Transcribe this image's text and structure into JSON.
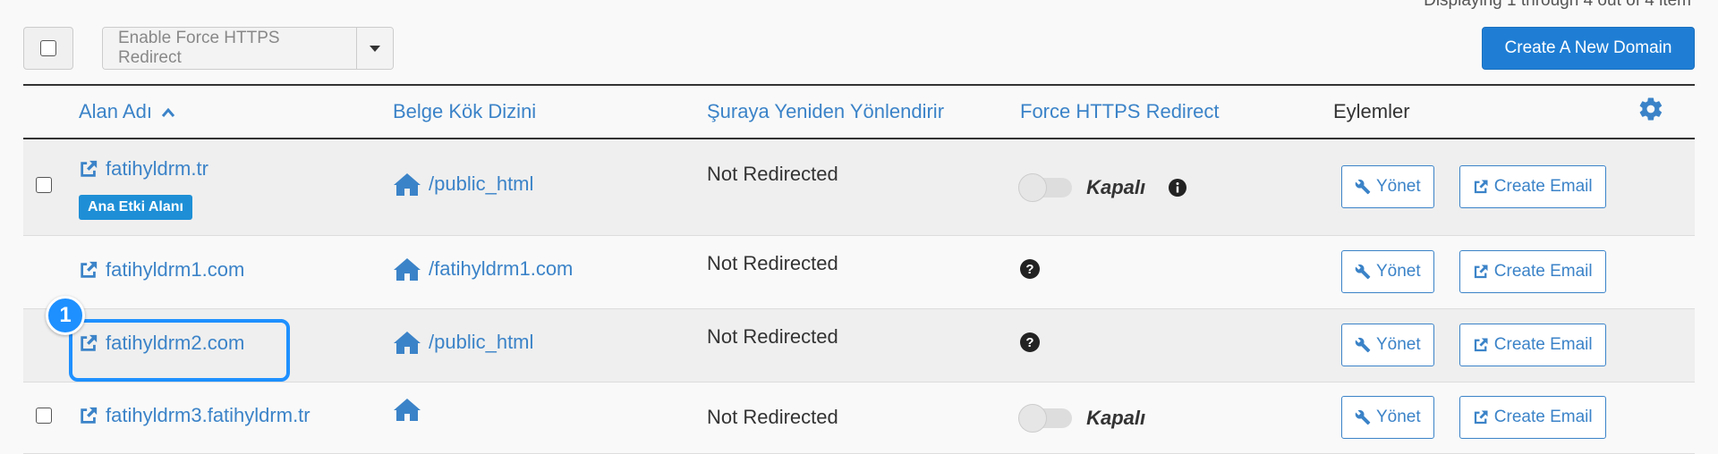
{
  "header": {
    "display_text": "Displaying 1 through 4 out of 4 item"
  },
  "toolbar": {
    "bulk_action_label": "Enable Force HTTPS Redirect",
    "create_label": "Create A New Domain"
  },
  "columns": {
    "domain": "Alan Adı",
    "docroot": "Belge Kök Dizini",
    "redirect": "Şuraya Yeniden Yönlendirir",
    "https": "Force HTTPS Redirect",
    "actions": "Eylemler"
  },
  "rows": [
    {
      "domain": "fatihyldrm.tr",
      "badge": "Ana Etki Alanı",
      "docroot": "/public_html",
      "redirect": "Not Redirected",
      "https_state": "Kapalı",
      "manage": "Yönet",
      "email": "Create Email"
    },
    {
      "domain": "fatihyldrm1.com",
      "docroot": "/fatihyldrm1.com",
      "redirect": "Not Redirected",
      "manage": "Yönet",
      "email": "Create Email"
    },
    {
      "domain": "fatihyldrm2.com",
      "docroot": "/public_html",
      "redirect": "Not Redirected",
      "manage": "Yönet",
      "email": "Create Email"
    },
    {
      "domain": "fatihyldrm3.fatihyldrm.tr",
      "docroot": "",
      "redirect": "Not Redirected",
      "https_state": "Kapalı",
      "manage": "Yönet",
      "email": "Create Email"
    }
  ],
  "highlight": {
    "number": "1"
  },
  "colors": {
    "link": "#3b83c8",
    "primary": "#1f7ed4",
    "highlight": "#1e90ff"
  }
}
